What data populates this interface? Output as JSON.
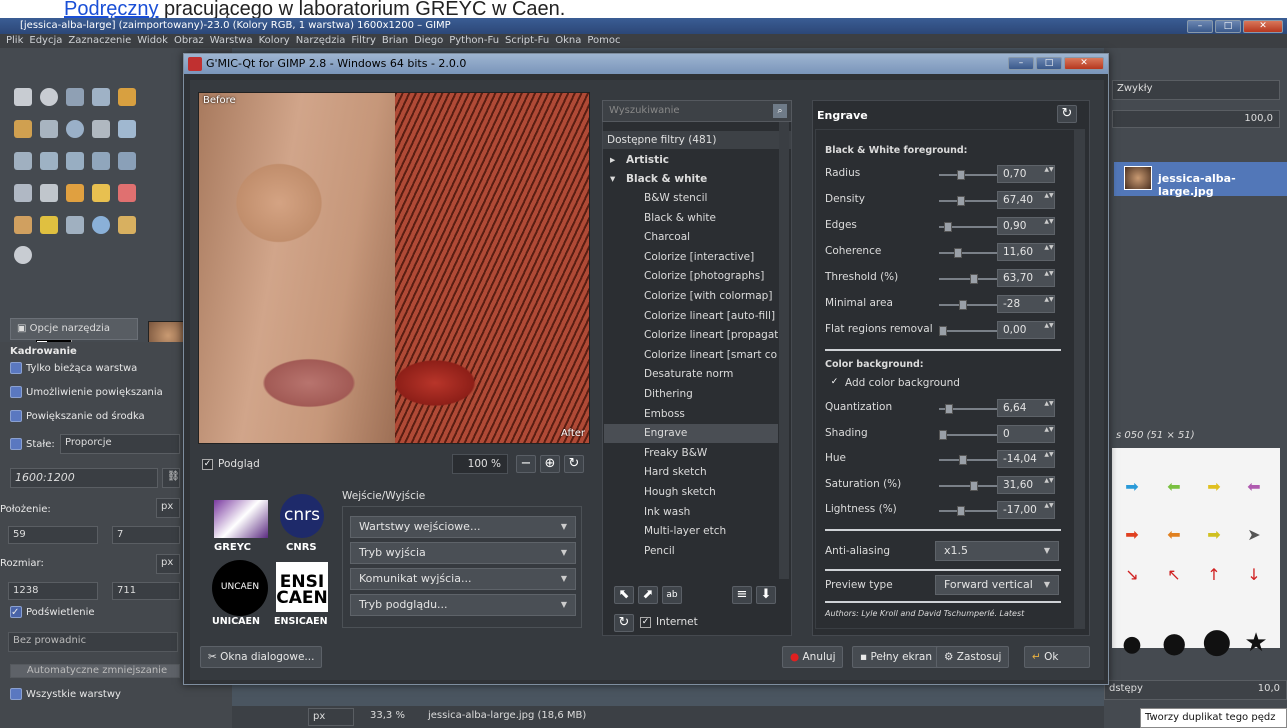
{
  "caption": {
    "link": "Podręczny",
    "rest": " pracującego w laboratorium GREYC w Caen."
  },
  "gimp": {
    "title": "[jessica-alba-large] (zaimportowany)-23.0 (Kolory RGB, 1 warstwa) 1600x1200 – GIMP",
    "menu": [
      "Plik",
      "Edycja",
      "Zaznaczenie",
      "Widok",
      "Obraz",
      "Warstwa",
      "Kolory",
      "Narzędzia",
      "Filtry",
      "Brian",
      "Diego",
      "Python-Fu",
      "Script-Fu",
      "Okna",
      "Pomoc"
    ],
    "tool_tab": "Opcje narzędzia",
    "tool_name": "Kadrowanie",
    "opts": {
      "current_layer": "Tylko bieżąca warstwa",
      "allow_grow": "Umożliwienie powiększania",
      "grow_center": "Powiększanie od środka",
      "fixed": "Stałe:",
      "fixed_value": "Proporcje",
      "ratio": "1600:1200",
      "position": "Położenie:",
      "unit": "px",
      "pos_x": "59",
      "pos_y": "7",
      "size": "Rozmiar:",
      "size_x": "1238",
      "size_y": "711",
      "highlight": "Podświetlenie",
      "guides": "Bez prowadnic",
      "auto_shrink": "Automatyczne zmniejszanie",
      "all_layers": "Wszystkie warstwy"
    },
    "right": {
      "mode": "Zwykły",
      "opacity": "100,0",
      "layer_name": "jessica-alba-large.jpg",
      "brush": "s 050 (51 × 51)",
      "spacing_label": "dstępy",
      "spacing": "10,0",
      "tooltip": "Tworzy duplikat tego pędz"
    },
    "status": {
      "unit": "px",
      "zoom": "33,3 %",
      "file": "jessica-alba-large.jpg (18,6 MB)"
    }
  },
  "gmic": {
    "title": "G'MIC-Qt for GIMP 2.8 - Windows 64 bits - 2.0.0",
    "before": "Before",
    "after": "After",
    "preview_label": "Podgląd",
    "zoom": "100 %",
    "io_title": "Wejście/Wyjście",
    "io": [
      "Wartstwy wejściowe...",
      "Tryb wyjścia",
      "Komunikat wyjścia...",
      "Tryb podglądu..."
    ],
    "logos": {
      "greyc": "GREYC",
      "cnrs": "cnrs",
      "cnrs_label": "CNRS",
      "unicaen": "UNICAEN",
      "ensi": "ENSI",
      "caen": "CAEN",
      "ensicaen": "ENSICAEN",
      "unicaen_logo": "UNCAEN"
    },
    "search_placeholder": "Wyszukiwanie",
    "filters_header": "Dostępne filtry (481)",
    "categories": [
      "Artistic",
      "Black & white"
    ],
    "filters": [
      "B&W stencil",
      "Black & white",
      "Charcoal",
      "Colorize [interactive]",
      "Colorize [photographs]",
      "Colorize [with colormap]",
      "Colorize lineart [auto-fill]",
      "Colorize lineart [propagation]",
      "Colorize lineart [smart coloring",
      "Desaturate norm",
      "Dithering",
      "Emboss",
      "Engrave",
      "Freaky B&W",
      "Hard sketch",
      "Hough sketch",
      "Ink wash",
      "Multi-layer etch",
      "Pencil"
    ],
    "internet": "Internet",
    "filter_name": "Engrave",
    "fg_section": "Black & White foreground:",
    "params": [
      {
        "label": "Radius",
        "value": "0,70",
        "pos": 0.35
      },
      {
        "label": "Density",
        "value": "67,40",
        "pos": 0.35
      },
      {
        "label": "Edges",
        "value": "0,90",
        "pos": 0.1
      },
      {
        "label": "Coherence",
        "value": "11,60",
        "pos": 0.3
      },
      {
        "label": "Threshold (%)",
        "value": "63,70",
        "pos": 0.62
      },
      {
        "label": "Minimal area",
        "value": "-28",
        "pos": 0.4
      }
    ],
    "flat_label": "Flat regions removal",
    "flat_value": "0,00",
    "bg_section": "Color background:",
    "add_bg": "Add color background",
    "bg_params": [
      {
        "label": "Quantization",
        "value": "6,64",
        "pos": 0.12
      },
      {
        "label": "Shading",
        "value": "0",
        "pos": 0.0
      },
      {
        "label": "Hue",
        "value": "-14,04",
        "pos": 0.4
      },
      {
        "label": "Saturation (%)",
        "value": "31,60",
        "pos": 0.62
      },
      {
        "label": "Lightness (%)",
        "value": "-17,00",
        "pos": 0.35
      }
    ],
    "aa_label": "Anti-aliasing",
    "aa_value": "x1.5",
    "pt_label": "Preview type",
    "pt_value": "Forward vertical",
    "authors": "Authors: Lyle Kroll and David Tschumperlé. Latest",
    "buttons": {
      "dialogs": "Okna dialogowe...",
      "cancel": "Anuluj",
      "fullscreen": "Pełny ekran",
      "apply": "Zastosuj",
      "ok": "Ok"
    }
  }
}
